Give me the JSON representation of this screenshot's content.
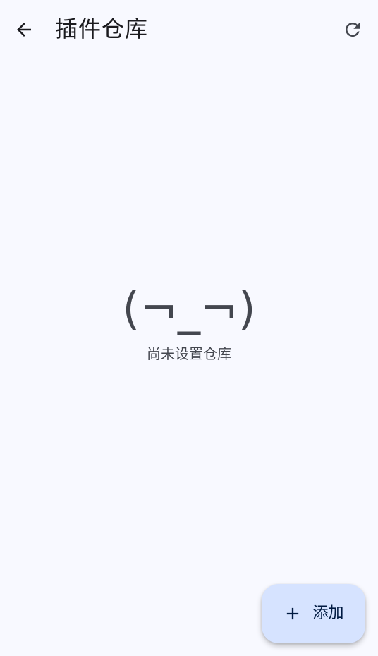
{
  "header": {
    "title": "插件仓库",
    "back_icon": "arrow-left-icon",
    "refresh_icon": "refresh-icon"
  },
  "empty_state": {
    "kaomoji": "(¬_¬)",
    "message": "尚未设置仓库"
  },
  "fab": {
    "icon": "plus-icon",
    "label": "添加"
  },
  "colors": {
    "background": "#f8f9ff",
    "fab_container": "#d6e3ff",
    "on_surface": "#1b1b1f",
    "on_surface_variant": "#44474f"
  }
}
